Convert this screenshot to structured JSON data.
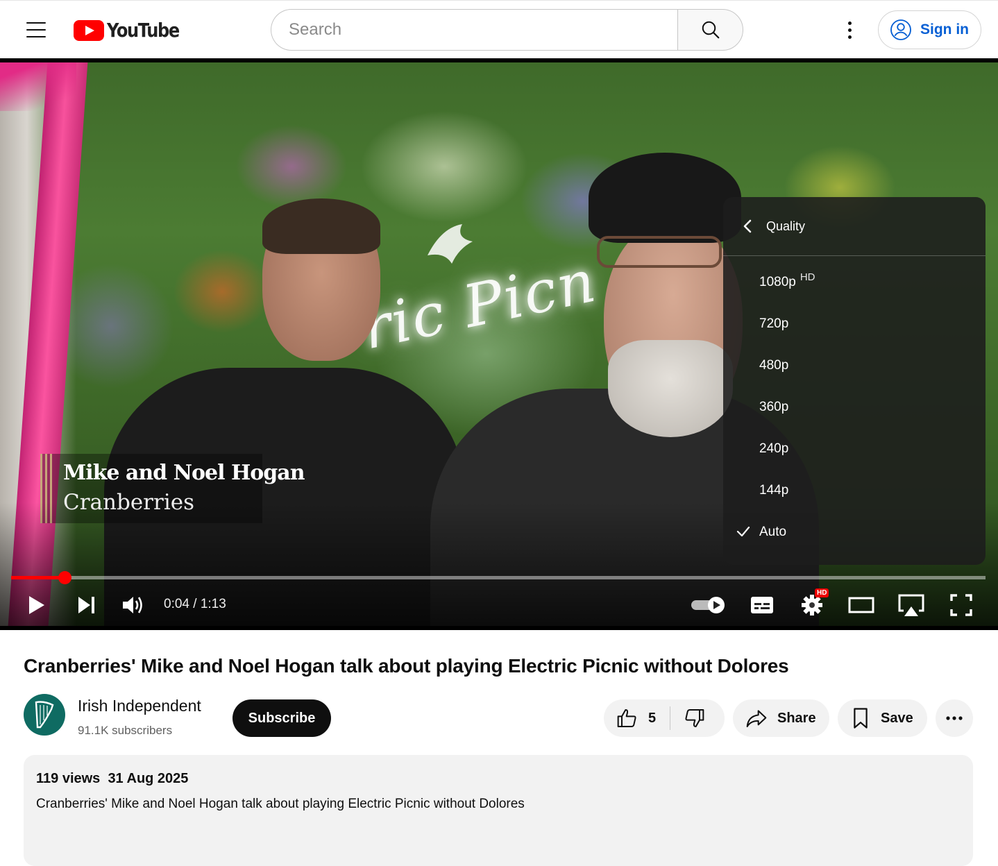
{
  "header": {
    "logo_text": "YouTube",
    "search_placeholder": "Search",
    "signin_label": "Sign in"
  },
  "player": {
    "overlay_name": "Mike and Noel Hogan",
    "overlay_subtitle": "Cranberries",
    "current_time": "0:04",
    "duration": "1:13",
    "time_display": "0:04 / 1:13",
    "progress_fraction": 0.055,
    "settings_badge": "HD",
    "quality_menu": {
      "title": "Quality",
      "options": [
        {
          "label": "1080p",
          "badge": "HD",
          "selected": false
        },
        {
          "label": "720p",
          "badge": "",
          "selected": false
        },
        {
          "label": "480p",
          "badge": "",
          "selected": false
        },
        {
          "label": "360p",
          "badge": "",
          "selected": false
        },
        {
          "label": "240p",
          "badge": "",
          "selected": false
        },
        {
          "label": "144p",
          "badge": "",
          "selected": false
        },
        {
          "label": "Auto",
          "badge": "",
          "selected": true
        }
      ]
    },
    "icons": [
      "play-icon",
      "next-icon",
      "volume-icon",
      "autoplay-toggle",
      "captions-icon",
      "settings-icon",
      "theater-mode-icon",
      "airplay-icon",
      "fullscreen-icon"
    ]
  },
  "video": {
    "title": "Cranberries' Mike and Noel Hogan talk about playing Electric Picnic without Dolores",
    "channel": "Irish Independent",
    "subscribers": "91.1K subscribers",
    "subscribe_label": "Subscribe",
    "likes": "5",
    "share_label": "Share",
    "save_label": "Save",
    "views": "119 views",
    "date": "31 Aug 2025",
    "description": "Cranberries' Mike and Noel Hogan talk about playing Electric Picnic without Dolores"
  },
  "colors": {
    "brand_red": "#ff0000",
    "link_blue": "#065fd4",
    "channel_avatar": "#0f6b62"
  }
}
